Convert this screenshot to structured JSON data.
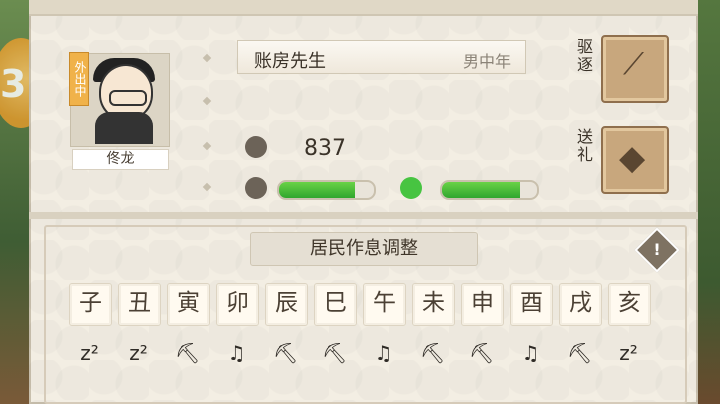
{
  "character": {
    "badge": "外出中",
    "name": "佟龙",
    "role": "账房先生",
    "age_gender": "男中年",
    "money": "837",
    "health_progress": 0.8,
    "mood_progress": 0.82
  },
  "actions": [
    {
      "label": "驱逐",
      "icon": "broom-icon"
    },
    {
      "label": "送礼",
      "icon": "gift-bag-icon"
    }
  ],
  "schedule": {
    "title": "居民作息调整",
    "hours": [
      "子",
      "丑",
      "寅",
      "卯",
      "辰",
      "巳",
      "午",
      "未",
      "申",
      "酉",
      "戌",
      "亥"
    ],
    "activities": [
      "zzz",
      "zzz",
      "work",
      "rest",
      "work",
      "work",
      "rest",
      "work",
      "work",
      "rest",
      "work",
      "zzz"
    ]
  },
  "colors": {
    "bar": "#3ba93a",
    "panel": "#f3eee3"
  }
}
